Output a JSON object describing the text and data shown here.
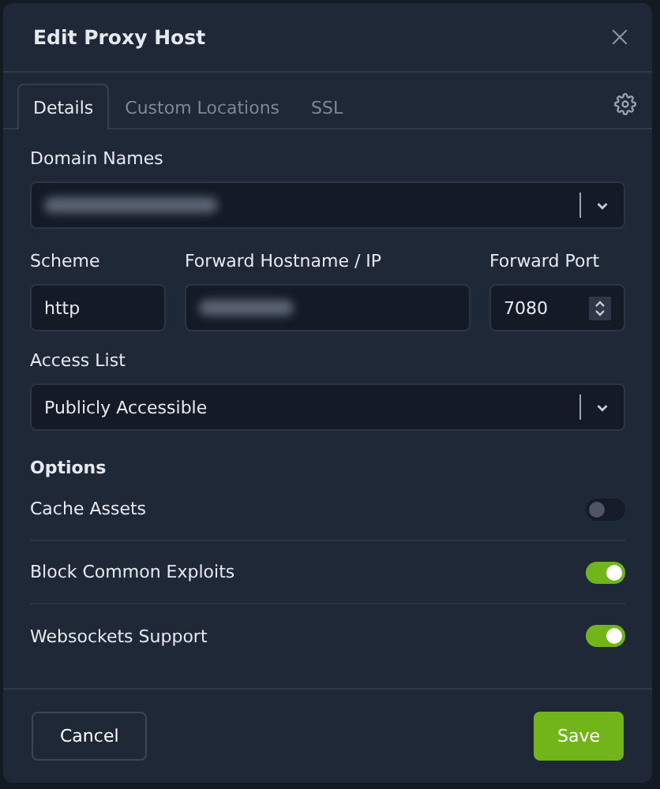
{
  "dialog": {
    "title": "Edit Proxy Host"
  },
  "tabs": [
    {
      "label": "Details",
      "selected": true
    },
    {
      "label": "Custom Locations",
      "selected": false
    },
    {
      "label": "SSL",
      "selected": false
    }
  ],
  "domain_names": {
    "label": "Domain Names"
  },
  "scheme": {
    "label": "Scheme",
    "value": "http"
  },
  "forward_hostname": {
    "label": "Forward Hostname / IP"
  },
  "forward_port": {
    "label": "Forward Port",
    "value": "7080"
  },
  "access_list": {
    "label": "Access List",
    "value": "Publicly Accessible"
  },
  "options": {
    "title": "Options",
    "items": [
      {
        "label": "Cache Assets",
        "on": false
      },
      {
        "label": "Block Common Exploits",
        "on": true
      },
      {
        "label": "Websockets Support",
        "on": true
      }
    ]
  },
  "buttons": {
    "cancel": "Cancel",
    "save": "Save"
  }
}
